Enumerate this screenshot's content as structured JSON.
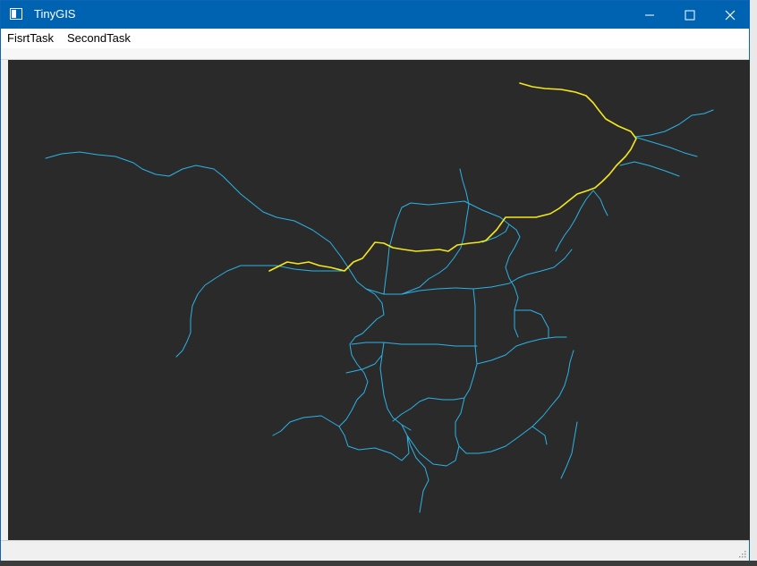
{
  "window": {
    "title": "TinyGIS"
  },
  "menubar": {
    "items": [
      {
        "label": "FisrtTask"
      },
      {
        "label": "SecondTask"
      }
    ]
  },
  "map": {
    "background": "#2a2a2a",
    "river_color": "#2bb3e6",
    "highlight_color": "#f4e81b"
  }
}
